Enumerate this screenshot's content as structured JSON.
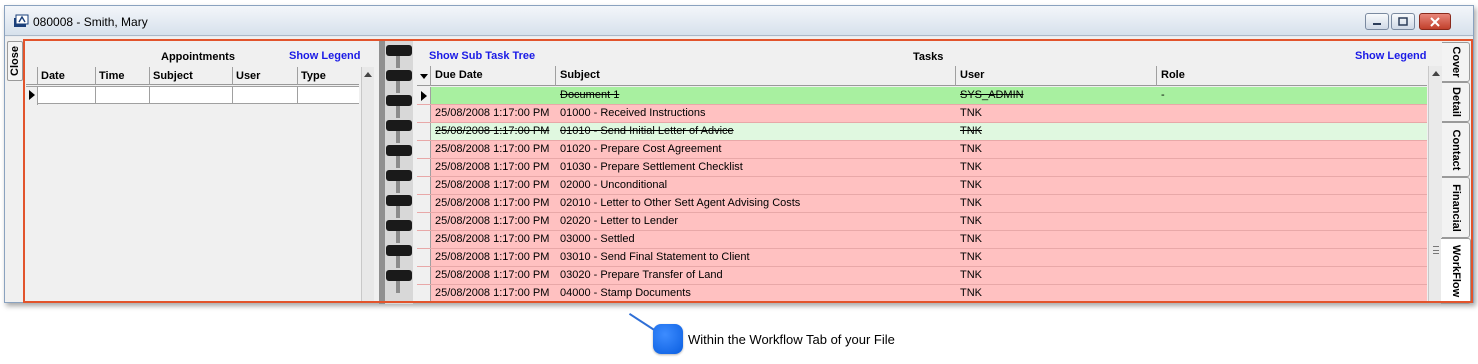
{
  "window": {
    "title": "080008 - Smith, Mary"
  },
  "side_tabs": {
    "close": "Close"
  },
  "appointments": {
    "title": "Appointments",
    "legend_link": "Show Legend",
    "columns": [
      "Date",
      "Time",
      "Subject",
      "User",
      "Type"
    ]
  },
  "tasks": {
    "title": "Tasks",
    "subtree_link": "Show Sub Task Tree",
    "legend_link": "Show Legend",
    "columns": [
      "Due Date",
      "Subject",
      "User",
      "Role"
    ],
    "rows": [
      {
        "due": "",
        "subject": "Document 1",
        "user": "SYS_ADMIN",
        "role": "-",
        "status": "current",
        "strike": true
      },
      {
        "due": "25/08/2008 1:17:00 PM",
        "subject": "01000 - Received Instructions",
        "user": "TNK",
        "role": "",
        "status": "overdue",
        "strike": false
      },
      {
        "due": "25/08/2008 1:17:00 PM",
        "subject": "01010 - Send Initial Letter of Advice",
        "user": "TNK",
        "role": "",
        "status": "done",
        "strike": true
      },
      {
        "due": "25/08/2008 1:17:00 PM",
        "subject": "01020 - Prepare Cost Agreement",
        "user": "TNK",
        "role": "",
        "status": "overdue",
        "strike": false
      },
      {
        "due": "25/08/2008 1:17:00 PM",
        "subject": "01030 - Prepare Settlement Checklist",
        "user": "TNK",
        "role": "",
        "status": "overdue",
        "strike": false
      },
      {
        "due": "25/08/2008 1:17:00 PM",
        "subject": "02000 - Unconditional",
        "user": "TNK",
        "role": "",
        "status": "overdue",
        "strike": false
      },
      {
        "due": "25/08/2008 1:17:00 PM",
        "subject": "02010 - Letter to Other Sett Agent Advising Costs",
        "user": "TNK",
        "role": "",
        "status": "overdue",
        "strike": false
      },
      {
        "due": "25/08/2008 1:17:00 PM",
        "subject": "02020 - Letter to Lender",
        "user": "TNK",
        "role": "",
        "status": "overdue",
        "strike": false
      },
      {
        "due": "25/08/2008 1:17:00 PM",
        "subject": "03000 - Settled",
        "user": "TNK",
        "role": "",
        "status": "overdue",
        "strike": false
      },
      {
        "due": "25/08/2008 1:17:00 PM",
        "subject": "03010 - Send Final Statement to Client",
        "user": "TNK",
        "role": "",
        "status": "overdue",
        "strike": false
      },
      {
        "due": "25/08/2008 1:17:00 PM",
        "subject": "03020 - Prepare Transfer of Land",
        "user": "TNK",
        "role": "",
        "status": "overdue",
        "strike": false
      },
      {
        "due": "25/08/2008 1:17:00 PM",
        "subject": "04000 - Stamp Documents",
        "user": "TNK",
        "role": "",
        "status": "overdue",
        "strike": false
      }
    ]
  },
  "right_tabs": [
    {
      "label": "Cover",
      "active": false
    },
    {
      "label": "Detail",
      "active": false
    },
    {
      "label": "Contact",
      "active": false
    },
    {
      "label": "Financial",
      "active": false
    },
    {
      "label": "WorkFlow",
      "active": true
    }
  ],
  "callout": {
    "text": "Within the Workflow Tab of your File"
  },
  "colors": {
    "overdue_row": "#ffc1c1",
    "current_row": "#a8f0a0",
    "done_row": "#e0f8e0",
    "highlight_frame": "#e2542c",
    "link": "#1a1ae6",
    "callout": "#0a5ee0"
  }
}
